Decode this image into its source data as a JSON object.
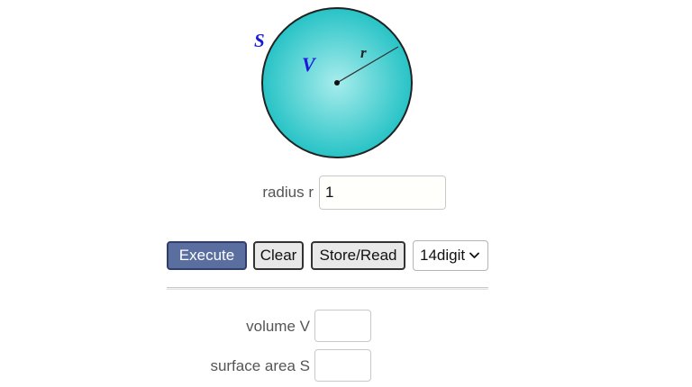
{
  "diagram": {
    "surface_symbol": "S",
    "volume_symbol": "V",
    "radius_symbol": "r",
    "colors": {
      "sphere_center": "#a8ecec",
      "sphere_edge": "#27c3c6",
      "sphere_outline": "#222222",
      "symbol_blue": "#1a1ad6"
    }
  },
  "inputs": {
    "radius": {
      "label": "radius r",
      "value": "1"
    }
  },
  "toolbar": {
    "execute_label": "Execute",
    "clear_label": "Clear",
    "store_read_label": "Store/Read",
    "precision_selected": "14digit"
  },
  "outputs": {
    "volume": {
      "label": "volume V",
      "value": ""
    },
    "surface_area": {
      "label": "surface area S",
      "value": ""
    }
  }
}
